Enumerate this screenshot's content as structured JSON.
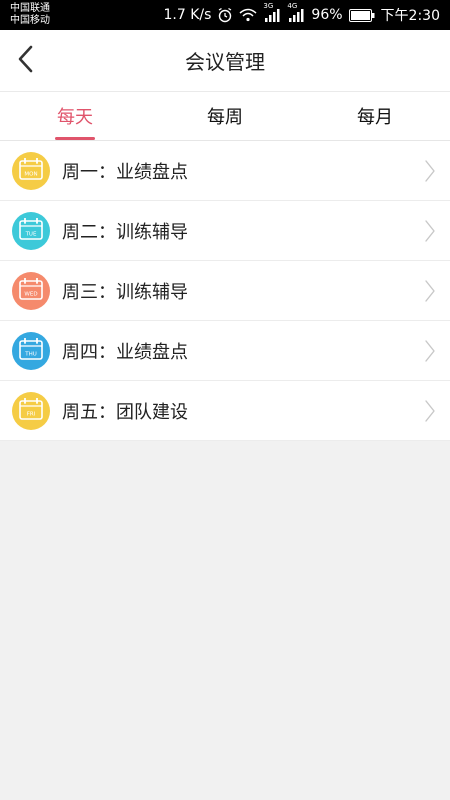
{
  "status_bar": {
    "carrier1": "中国联通",
    "carrier2": "中国移动",
    "net_speed": "1.7 K/s",
    "battery": "96%",
    "time": "下午2:30",
    "badge_3g": "3G",
    "badge_4g": "4G"
  },
  "header": {
    "title": "会议管理"
  },
  "tabs": [
    {
      "label": "每天",
      "active": true
    },
    {
      "label": "每周",
      "active": false
    },
    {
      "label": "每月",
      "active": false
    }
  ],
  "meetings": [
    {
      "label": "周一：业绩盘点",
      "day": "MON",
      "color": "#f5cc45"
    },
    {
      "label": "周二：训练辅导",
      "day": "TUE",
      "color": "#3dc9d9"
    },
    {
      "label": "周三：训练辅导",
      "day": "WED",
      "color": "#f58a6c"
    },
    {
      "label": "周四：业绩盘点",
      "day": "THU",
      "color": "#34a8e0"
    },
    {
      "label": "周五：团队建设",
      "day": "FRI",
      "color": "#f5cc45"
    }
  ],
  "colors": {
    "accent": "#e0546b"
  }
}
